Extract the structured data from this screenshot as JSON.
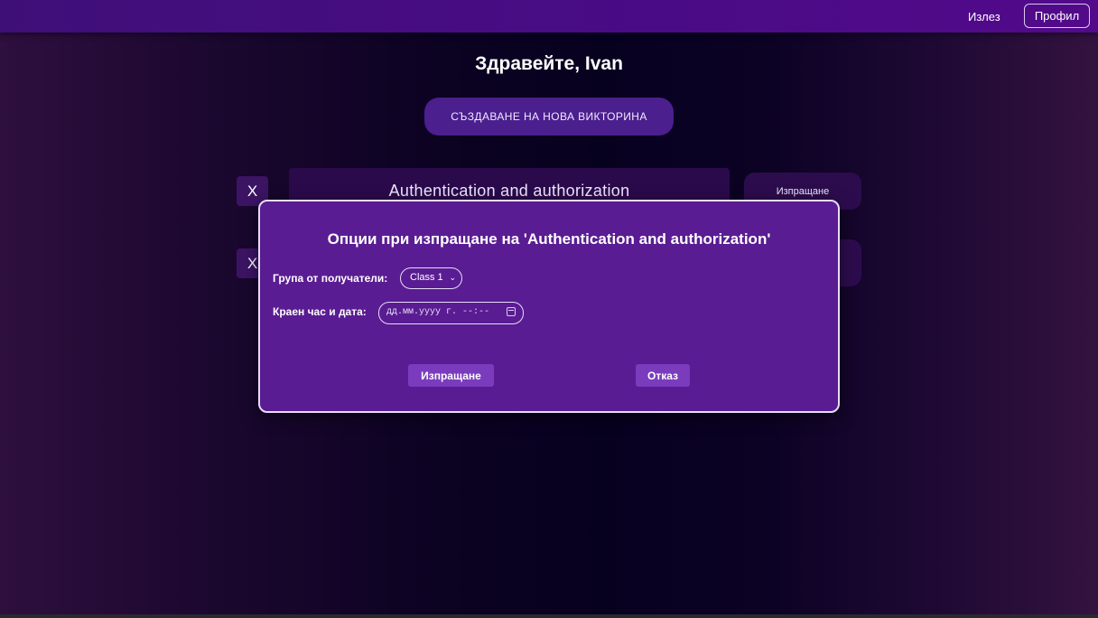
{
  "header": {
    "logout_label": "Излез",
    "profile_label": "Профил"
  },
  "main": {
    "greeting": "Здравейте, Ivan",
    "create_quiz_label": "СЪЗДАВАНЕ НА НОВА ВИКТОРИНА",
    "quizzes": [
      {
        "delete_label": "X",
        "title": "Authentication and authorization",
        "send_label": "Изпращане"
      },
      {
        "delete_label": "X"
      }
    ]
  },
  "modal": {
    "title": "Опции при изпращане на 'Authentication and authorization'",
    "group_label": "Група от получатели:",
    "group_selected": "Class 1",
    "deadline_label": "Краен час и дата:",
    "deadline_placeholder": "дд.мм.уууу г. --:--",
    "send_label": "Изпращане",
    "cancel_label": "Отказ"
  },
  "colors": {
    "topbar": "#4a0b86",
    "modal_bg": "#5a1c92",
    "modal_button": "#7a3cbc",
    "create_button": "#4b1f8e"
  }
}
